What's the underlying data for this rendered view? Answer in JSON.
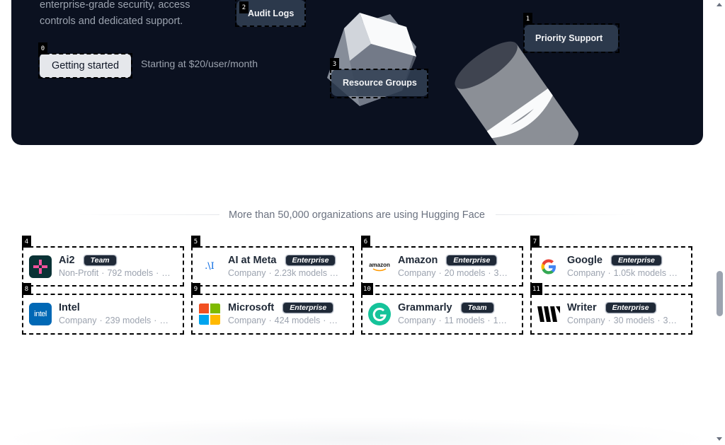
{
  "hero": {
    "description_lines": [
      "enterprise-grade security, access",
      "controls and dedicated support."
    ],
    "cta_label": "Getting started",
    "price_text": "Starting at $20/user/month",
    "chips": {
      "audit_logs": "Audit Logs",
      "resource_groups": "Resource Groups",
      "priority_support": "Priority Support"
    }
  },
  "annotations": [
    "0",
    "1",
    "2",
    "3",
    "4",
    "5",
    "6",
    "7",
    "8",
    "9",
    "10",
    "11"
  ],
  "orgs_section": {
    "title": "More than 50,000 organizations are using Hugging Face",
    "orgs": [
      {
        "name": "Ai2",
        "badge": "Team",
        "type": "Non-Profit",
        "models": "792 models",
        "more": "…"
      },
      {
        "name": "AI at Meta",
        "badge": "Enterprise",
        "type": "Company",
        "models": "2.23k models",
        "more": "…"
      },
      {
        "name": "Amazon",
        "badge": "Enterprise",
        "type": "Company",
        "models": "20 models",
        "more": "3…"
      },
      {
        "name": "Google",
        "badge": "Enterprise",
        "type": "Company",
        "models": "1.05k models",
        "more": "…"
      },
      {
        "name": "Intel",
        "badge": "",
        "type": "Company",
        "models": "239 models",
        "more": "…"
      },
      {
        "name": "Microsoft",
        "badge": "Enterprise",
        "type": "Company",
        "models": "424 models",
        "more": "…"
      },
      {
        "name": "Grammarly",
        "badge": "Team",
        "type": "Company",
        "models": "11 models",
        "more": "1…"
      },
      {
        "name": "Writer",
        "badge": "Enterprise",
        "type": "Company",
        "models": "30 models",
        "more": "3…"
      }
    ]
  },
  "colors": {
    "hero_bg": "#0b1120",
    "badge_bg": "#1f2937",
    "muted_text": "#9ca3af"
  }
}
